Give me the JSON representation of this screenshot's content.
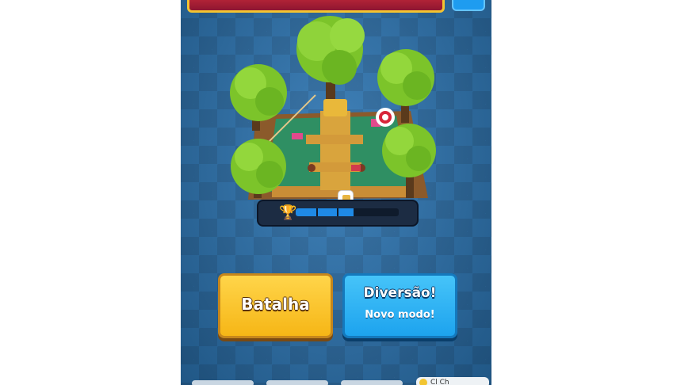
{
  "game": {
    "arena_name": "",
    "trophy_progress": 0.56
  },
  "buttons": {
    "battle_label": "Batalha",
    "fun_title": "Diversão!",
    "fun_subtitle": "Novo modo!"
  },
  "footer": {
    "chest_text": "Cl  Ch"
  },
  "colors": {
    "battle": "#f6b616",
    "fun": "#1da3ee",
    "background": "#2b74b2"
  },
  "icons": [
    "trophy-icon",
    "card-badge-icon",
    "target-icon"
  ]
}
